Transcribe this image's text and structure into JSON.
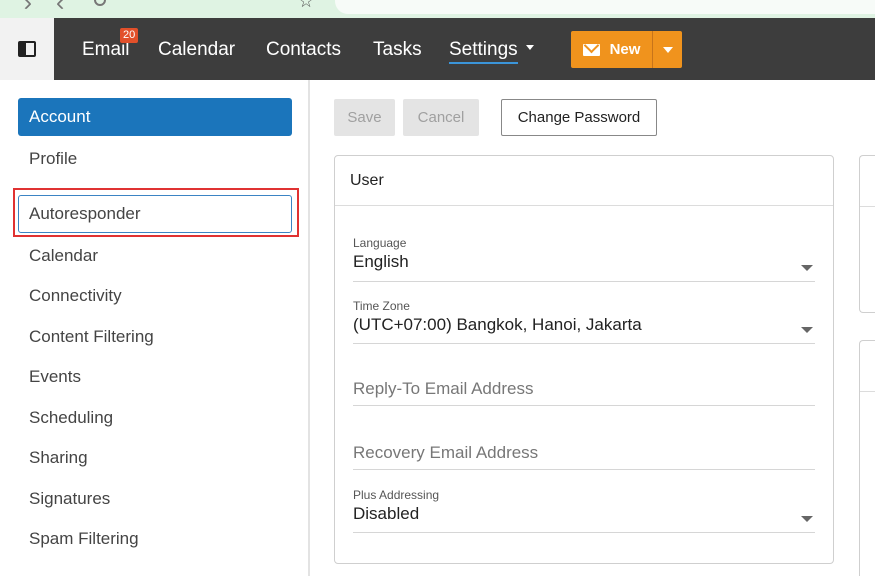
{
  "topnav": {
    "items": [
      "Email",
      "Calendar",
      "Contacts",
      "Tasks",
      "Settings"
    ],
    "email_badge": "20",
    "new_button": "New"
  },
  "sidebar": {
    "items": [
      "Account",
      "Profile",
      "Autoresponder",
      "Calendar",
      "Connectivity",
      "Content Filtering",
      "Events",
      "Scheduling",
      "Sharing",
      "Signatures",
      "Spam Filtering"
    ],
    "active": "Account",
    "focused": "Autoresponder"
  },
  "toolbar": {
    "save": "Save",
    "cancel": "Cancel",
    "change_password": "Change Password"
  },
  "user_panel": {
    "title": "User",
    "language_label": "Language",
    "language_value": "English",
    "timezone_label": "Time Zone",
    "timezone_value": "(UTC+07:00) Bangkok, Hanoi, Jakarta",
    "reply_to_placeholder": "Reply-To Email Address",
    "recovery_placeholder": "Recovery Email Address",
    "plus_label": "Plus Addressing",
    "plus_value": "Disabled"
  },
  "colors": {
    "nav_bg": "#3d3d3d",
    "accent_blue": "#1b75bb",
    "new_orange": "#f0931d",
    "badge_red": "#e2502a",
    "highlight_red": "#e03232"
  }
}
